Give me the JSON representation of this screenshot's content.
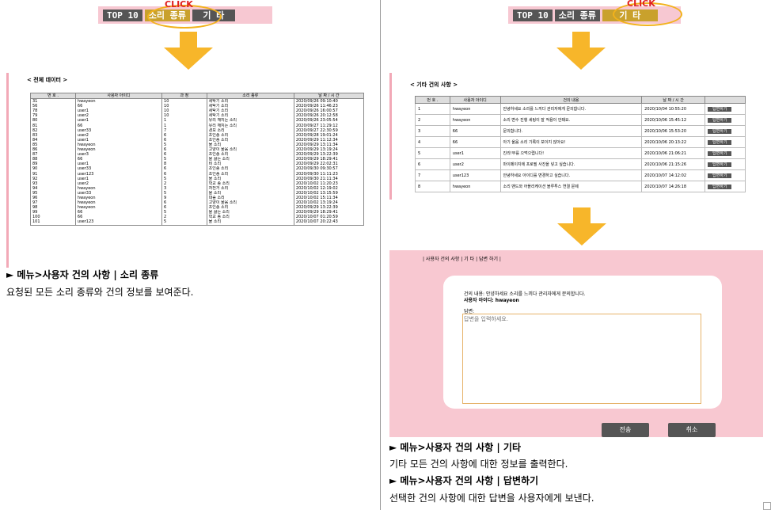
{
  "click_label": "CLICK",
  "accent_color": "#f7b62a",
  "left": {
    "tabs": [
      "TOP 10",
      "소리 종류",
      "기 타"
    ],
    "section_title": "< 전체 데이터 >",
    "table_headers": [
      "번 호 .",
      "사용자 아이디",
      "과 정",
      "소리 종류",
      "날 짜 / 시 간"
    ],
    "rows": [
      [
        "31",
        "hwayeon",
        "10",
        "세탁기 소리",
        "2020/09/26 09:10:40"
      ],
      [
        "56",
        "66",
        "10",
        "세탁기 소리",
        "2020/09/26 11:46:23"
      ],
      [
        "78",
        "user1",
        "10",
        "세탁기 소리",
        "2020/09/26 16:00:57"
      ],
      [
        "79",
        "user2",
        "10",
        "세탁기 소리",
        "2020/09/26 20:12:58"
      ],
      [
        "80",
        "user1",
        "1",
        "유리 깨지는 소리",
        "2020/09/26 23:05:54"
      ],
      [
        "81",
        "66",
        "1",
        "유리 깨지는 소리",
        "2020/09/27 11:29:12"
      ],
      [
        "82",
        "user33",
        "7",
        "경보 소리",
        "2020/09/27 22:30:59"
      ],
      [
        "83",
        "user2",
        "6",
        "초인종 소리",
        "2020/09/28 19:01:24"
      ],
      [
        "84",
        "user1",
        "6",
        "초인종 소리",
        "2020/09/29 11:12:34"
      ],
      [
        "85",
        "hwayeon",
        "5",
        "물 소리",
        "2020/09/29 13:11:34"
      ],
      [
        "86",
        "hwayeon",
        "6",
        "고양이 울음 소리",
        "2020/09/29 13:19:24"
      ],
      [
        "87",
        "user3",
        "6",
        "초인종 소리",
        "2020/09/29 13:22:39"
      ],
      [
        "88",
        "66",
        "5",
        "물 끓는 소리",
        "2020/09/29 18:29:41"
      ],
      [
        "89",
        "user1",
        "8",
        "비 소리",
        "2020/09/29 22:02:31"
      ],
      [
        "90",
        "user33",
        "6",
        "초인종 소리",
        "2020/09/30 09:30:57"
      ],
      [
        "91",
        "user123",
        "6",
        "초인종 소리",
        "2020/09/30 11:11:23"
      ],
      [
        "92",
        "user1",
        "5",
        "물 소리",
        "2020/09/30 21:11:34"
      ],
      [
        "93",
        "user2",
        "2",
        "학교 종 소리",
        "2020/10/02 11:20:23"
      ],
      [
        "94",
        "hwayeon",
        "3",
        "자전거 소리",
        "2020/10/02 12:19:02"
      ],
      [
        "95",
        "user33",
        "5",
        "물 소리",
        "2020/10/02 13:15:59"
      ],
      [
        "96",
        "hwayeon",
        "9",
        "대숲 소리",
        "2020/10/02 15:11:34"
      ],
      [
        "97",
        "hwayeon",
        "6",
        "고양이 울음 소리",
        "2020/10/02 13:19:24"
      ],
      [
        "98",
        "hwayeon",
        "6",
        "초인종 소리",
        "2020/09/29 13:22:39"
      ],
      [
        "99",
        "66",
        "5",
        "물 끓는 소리",
        "2020/09/29 18:29:41"
      ],
      [
        "100",
        "66",
        "2",
        "학교 종 소리",
        "2020/10/07 01:20:59"
      ],
      [
        "101",
        "user123",
        "5",
        "물 소리",
        "2020/10/07 20:22:43"
      ]
    ],
    "heading": "► 메뉴>사용자 건의 사항 | 소리 종류",
    "description": "요청된 모든 소리 종류와 건의 정보를 보여준다."
  },
  "right": {
    "tabs": [
      "TOP 10",
      "소리 종류",
      "기 타"
    ],
    "section_title": "< 기타 건의 사항 >",
    "table_headers": [
      "번 호 .",
      "사용자 아이디",
      "건의 내용",
      "날 짜 / 시 간",
      ""
    ],
    "rows": [
      [
        "1",
        "hwayeon",
        "안녕하세요 소리를 느끼다 관리자에게 문의합니다.",
        "2020/10/04 10:55:20",
        "답변하기"
      ],
      [
        "2",
        "hwayeon",
        "소리 변수 진행 세팅이 잘 적용이 안돼요.",
        "2020/10/06 15:45:12",
        "답변하기"
      ],
      [
        "3",
        "66",
        "문의합니다.",
        "2020/10/06 15:53:20",
        "답변하기"
      ],
      [
        "4",
        "66",
        "아기 울음 소리 기록이 보이지 않아요!",
        "2020/10/06 20:13:22",
        "답변하기"
      ],
      [
        "5",
        "user1",
        "진리!부를 으먹으렵니다!",
        "2020/10/06 21:06:21",
        "답변하기"
      ],
      [
        "6",
        "user2",
        "마이페이지에 프로필 사진을 넣고 싶습니다.",
        "2020/10/06 21:15:26",
        "답변하기"
      ],
      [
        "7",
        "user123",
        "안녕하세요 아이디를 변경하고 싶습니다.",
        "2020/10/07 14:12:02",
        "답변하기"
      ],
      [
        "8",
        "hwayeon",
        "소리 밴드와 어플리케이션 블루투스 연결 문제",
        "2020/10/07 14:26:18",
        "답변하기"
      ]
    ],
    "form": {
      "nav": "| 사용자 건의 사항 | 기 타 | 답변 하기 |",
      "content_line": "건의 내용: 안녕하세요 소리를 느끼다 관리자에게 문의합니다.",
      "user_line": "사용자 아이디: hwayeon",
      "answer_label": "답변:",
      "answer_placeholder": "답변을 입력하세요.",
      "submit": "전송",
      "cancel": "취소"
    },
    "heading1": "► 메뉴>사용자 건의 사항 | 기타",
    "description1": "기타 모든 건의 사항에 대한 정보를 출력한다.",
    "heading2": "► 메뉴>사용자 건의 사항 | 답변하기",
    "description2": "선택한 건의 사항에 대한 답변을 사용자에게 보낸다."
  }
}
